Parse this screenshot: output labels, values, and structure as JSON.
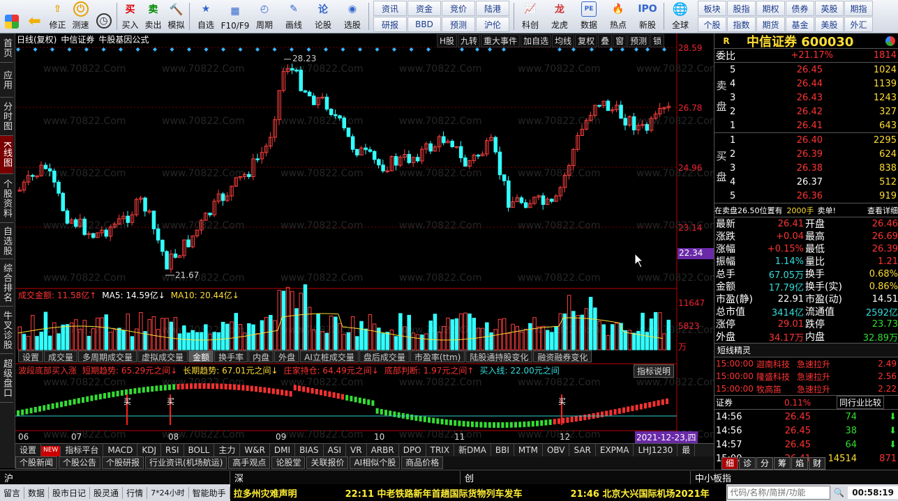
{
  "toolbar": {
    "items1": [
      {
        "label": "",
        "icon": "windows-icon"
      },
      {
        "label": "",
        "icon": "back-arrow-icon"
      },
      {
        "label": "修正",
        "icon": "up-arrow-icon"
      },
      {
        "label": "测速",
        "icon": "speed-icon"
      },
      {
        "label": "",
        "icon": "clock-icon"
      }
    ],
    "trade": [
      {
        "label": "买入",
        "icon_text": "买"
      },
      {
        "label": "卖出",
        "icon_text": "卖"
      },
      {
        "label": "模拟",
        "icon_text": "锤"
      }
    ],
    "view": [
      {
        "label": "自选"
      },
      {
        "label": "F10/F9"
      },
      {
        "label": "周期"
      },
      {
        "label": "画线"
      },
      {
        "label": "论股"
      },
      {
        "label": "选股"
      }
    ],
    "grid_top": [
      "资讯",
      "资金",
      "竞价",
      "陆港"
    ],
    "grid_bottom": [
      "研报",
      "BBD",
      "预测",
      "沪伦"
    ],
    "tools": [
      {
        "label": "科创"
      },
      {
        "label": "龙虎"
      },
      {
        "label": "数据"
      },
      {
        "label": "热点"
      },
      {
        "label": "新股"
      }
    ],
    "global_label": "全球",
    "grid2_top": [
      "板块",
      "股指",
      "期权",
      "债券",
      "英股",
      "期指"
    ],
    "grid2_bottom": [
      "个股",
      "指数",
      "期货",
      "基金",
      "美股",
      "外汇"
    ]
  },
  "leftnav": [
    "首页",
    "应用",
    "分时图",
    "K线图",
    "个股资料",
    "自选股",
    "综合排名",
    "牛叉诊股",
    "超级盘口"
  ],
  "chart": {
    "header_left": "日线(复权)",
    "stock_name": "中信证券",
    "formula": "牛股基因公式",
    "buttons": [
      "H股",
      "九转",
      "重大事件",
      "加自选",
      "均线",
      "复权",
      "叠",
      "窗",
      "预测",
      "锁"
    ],
    "y_ticks": [
      "28.59",
      "26.78",
      "24.96",
      "23.14"
    ],
    "price_cursor": "22.34",
    "high_label": "28.23",
    "low_label": "21.67",
    "watermark": "www.70822.Com",
    "vol_title": "成交金额: 11.58亿↑",
    "ma5": "MA5: 14.59亿↓",
    "ma10": "MA10: 20.44亿↓",
    "vol_y": [
      "11647",
      "5823",
      "万"
    ],
    "vol_tabs": [
      "设置",
      "成交量",
      "多周期成交量",
      "虚拟成交量",
      "金额",
      "换手率",
      "内盘",
      "外盘",
      "AI立桩成交量",
      "盘后成交量",
      "市盈率(ttm)",
      "陆股通持股变化",
      "融资融券变化"
    ],
    "ind_title": "波段底部买入涨",
    "ind_short": "短期趋势: 65.29元之间↓",
    "ind_long": "长期趋势: 67.01元之间↓",
    "ind_zj": "庄家持仓: 64.49元之间↓",
    "ind_bottom": "底部判断: 1.97元之间↑",
    "ind_buy": "买入线: 22.00元之间",
    "ind_explain": "指标说明",
    "buy_mark": "买",
    "x_months": [
      "06",
      "07",
      "08",
      "09",
      "10",
      "11",
      "12"
    ],
    "date_cursor": "2021-12-23,四"
  },
  "bottom_tabs": [
    "设置",
    "NEW",
    "指标平台",
    "MACD",
    "KDJ",
    "RSI",
    "BOLL",
    "主力",
    "W&R",
    "DMI",
    "BIAS",
    "ASI",
    "VR",
    "ARBR",
    "DPO",
    "TRIX",
    "新DMA",
    "BBI",
    "MTM",
    "OBV",
    "SAR",
    "EXPMA",
    "LHJ1230",
    "最"
  ],
  "news_tabs": [
    "个股新闻",
    "个股公告",
    "个股研报",
    "行业资讯(机场航运)",
    "高手观点",
    "论股堂",
    "关联报价",
    "AI相似个股",
    "商品价格"
  ],
  "mktbar": {
    "sh": "沪",
    "sz": "深",
    "cy": "创",
    "zx": "中小板指"
  },
  "status": {
    "items": [
      "留言",
      "数据",
      "股市日记",
      "股灵通",
      "行情",
      "7*24小时",
      "智能助手"
    ],
    "ticker": "拉多州灾难声明",
    "news1": "22:11 中老铁路新年首趟国际货物列车发车",
    "news2": "21:46 北京大兴国际机场2021年",
    "search_placeholder": "代码/名称/简拼/功能",
    "time": "00:58:19"
  },
  "rp": {
    "flag": "R",
    "name": "中信证券 600030",
    "weibi_label": "委比",
    "weibi": "+21.17%",
    "weibi_val": "1814",
    "sell_label": [
      "卖",
      "盘"
    ],
    "buy_label": [
      "买",
      "盘"
    ],
    "sells": [
      {
        "lv": "5",
        "price": "26.45",
        "vol": "1024"
      },
      {
        "lv": "4",
        "price": "26.44",
        "vol": "1139"
      },
      {
        "lv": "3",
        "price": "26.43",
        "vol": "1243"
      },
      {
        "lv": "2",
        "price": "26.42",
        "vol": "327"
      },
      {
        "lv": "1",
        "price": "26.41",
        "vol": "643"
      }
    ],
    "buys": [
      {
        "lv": "1",
        "price": "26.40",
        "vol": "2295"
      },
      {
        "lv": "2",
        "price": "26.39",
        "vol": "624"
      },
      {
        "lv": "3",
        "price": "26.38",
        "vol": "838"
      },
      {
        "lv": "4",
        "price": "26.37",
        "vol": "512"
      },
      {
        "lv": "5",
        "price": "26.36",
        "vol": "919"
      }
    ],
    "notice": "在卖盘26.50位置有",
    "notice_vol": "2000手",
    "notice_act": "卖单!",
    "notice_more": "查看详细",
    "stats": [
      [
        "最新",
        "26.41",
        "开盘",
        "26.46"
      ],
      [
        "涨跌",
        "+0.04",
        "最高",
        "26.69"
      ],
      [
        "涨幅",
        "+0.15%",
        "最低",
        "26.39"
      ],
      [
        "振幅",
        "1.14%",
        "量比",
        "1.21"
      ],
      [
        "总手",
        "67.05万",
        "换手",
        "0.68%"
      ],
      [
        "金额",
        "17.79亿",
        "换手(实)",
        "0.86%"
      ],
      [
        "市盈(静)",
        "22.91",
        "市盈(动)",
        "14.51"
      ],
      [
        "总市值",
        "3414亿",
        "流通值",
        "2592亿"
      ],
      [
        "涨停",
        "29.01",
        "跌停",
        "23.73"
      ],
      [
        "外盘",
        "34.17万",
        "内盘",
        "32.89万"
      ]
    ],
    "spirit_title": "短线精灵",
    "spirit": [
      [
        "15:00:00",
        "迦南科技",
        "急速拉升",
        "2.49"
      ],
      [
        "15:00:00",
        "隆盛科技",
        "急速拉升",
        "2.56"
      ],
      [
        "15:00:00",
        "牧高笛",
        "急速拉升",
        "2.22"
      ]
    ],
    "sector_label": "证券",
    "sector_pct": "0.11%",
    "compare": "同行业比较",
    "ticks": [
      [
        "14:56",
        "26.45",
        "74",
        ""
      ],
      [
        "14:56",
        "26.45",
        "38",
        ""
      ],
      [
        "14:57",
        "26.45",
        "64",
        ""
      ],
      [
        "15:00",
        "26.41",
        "14514",
        "871"
      ]
    ],
    "tabs": [
      "细",
      "诊",
      "分",
      "筹",
      "焰",
      "财"
    ]
  }
}
